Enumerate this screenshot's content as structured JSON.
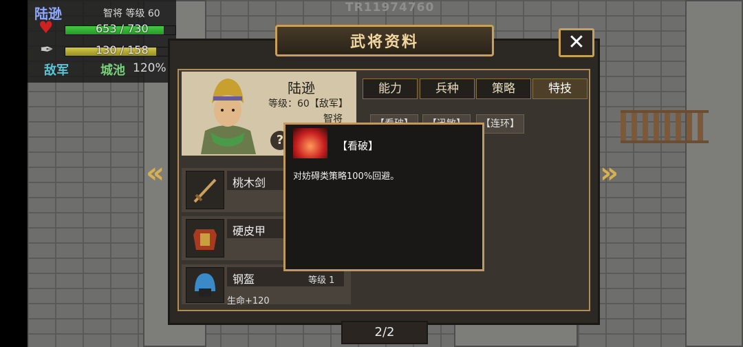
{
  "watermark": "TR11974760",
  "unit": {
    "name": "陆逊",
    "class_level": "智将 等级 60",
    "hp": {
      "current": 653,
      "max": 730,
      "text": "653 / 730"
    },
    "mp": {
      "current": 130,
      "max": 158,
      "text": "130 / 158"
    },
    "faction": "敌军",
    "terrain": "城池",
    "terrain_value": "120%"
  },
  "dialog": {
    "title": "武将资料",
    "close_icon": "close-x-icon",
    "general": {
      "name": "陆逊",
      "level_line": "等级：60【敌军】",
      "class": "智将",
      "help_icon": "?"
    },
    "equipment": [
      {
        "name": "桃木剑",
        "icon": "sword-icon",
        "level": "",
        "bonus": ""
      },
      {
        "name": "硬皮甲",
        "icon": "armor-icon",
        "level": "",
        "bonus": ""
      },
      {
        "name": "钢盔",
        "icon": "helmet-icon",
        "level": "等级 1",
        "bonus": "生命+120"
      }
    ],
    "tabs": [
      {
        "label": "能力",
        "active": false
      },
      {
        "label": "兵种",
        "active": false
      },
      {
        "label": "策略",
        "active": false
      },
      {
        "label": "特技",
        "active": true
      }
    ],
    "skills": [
      "【看破】",
      "【迅敏】",
      "【连环】"
    ],
    "tooltip": {
      "title": "【看破】",
      "description": "对妨碍类策略100%回避。"
    },
    "page": "2/2"
  }
}
